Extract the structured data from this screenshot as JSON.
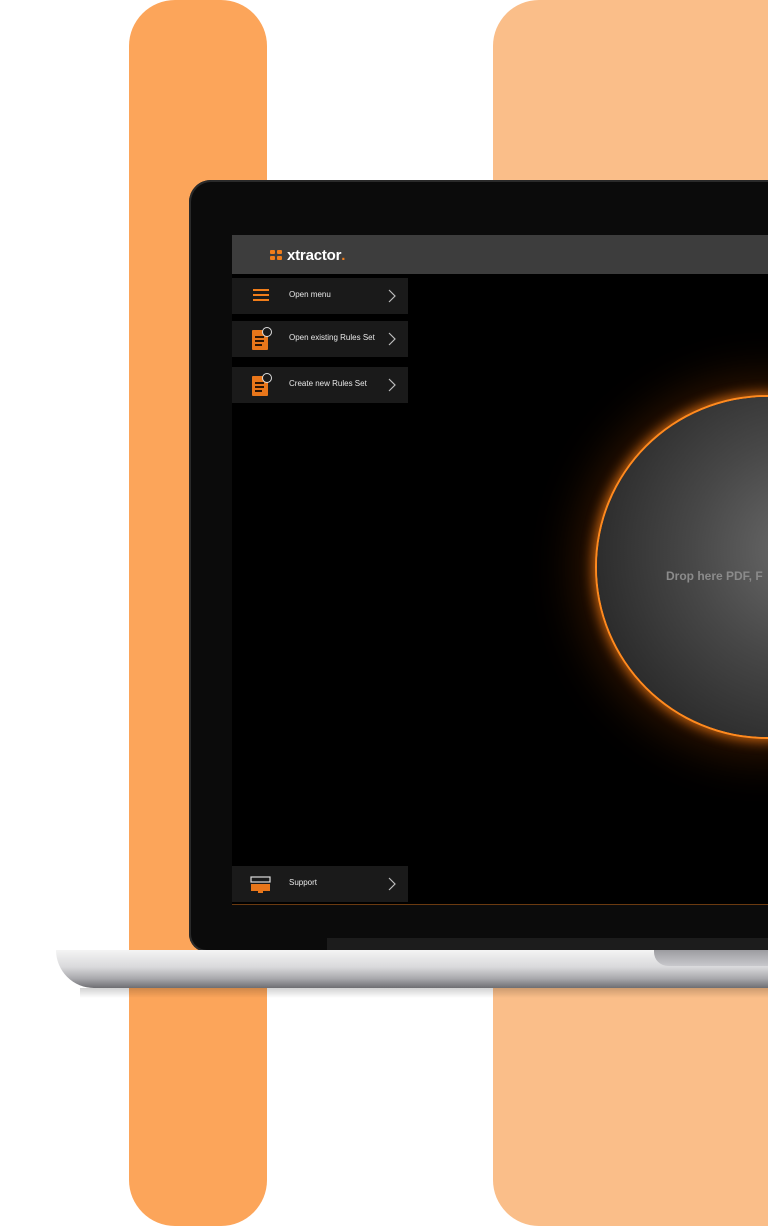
{
  "app": {
    "brand_name": "xtractor",
    "brand_dot": ".",
    "accent_color": "#f07d1a"
  },
  "sidebar": {
    "items": [
      {
        "label": "Open menu",
        "icon": "hamburger-icon"
      },
      {
        "label": "Open existing Rules Set",
        "icon": "document-search-icon"
      },
      {
        "label": "Create new Rules Set",
        "icon": "document-add-icon"
      }
    ],
    "footer": {
      "label": "Support",
      "icon": "support-icon"
    }
  },
  "drop_zone": {
    "text": "Drop here PDF, F"
  }
}
